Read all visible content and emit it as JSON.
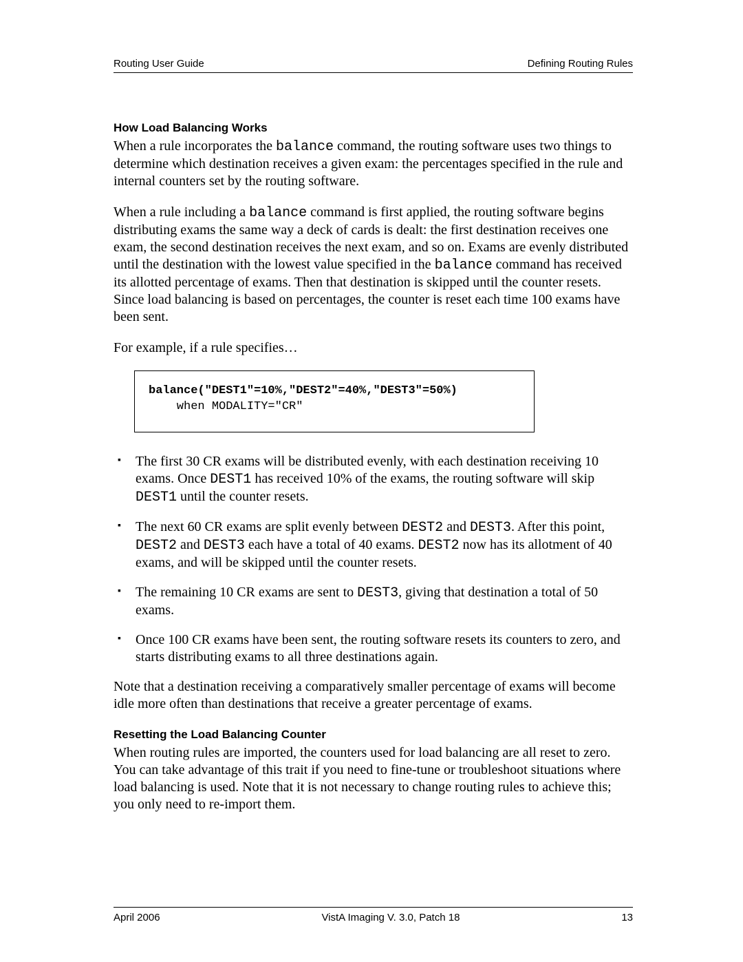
{
  "header": {
    "left": "Routing User Guide",
    "right": "Defining Routing Rules"
  },
  "section1": {
    "heading": "How Load Balancing Works",
    "p1_a": "When a rule incorporates the ",
    "p1_code": "balance",
    "p1_b": " command, the routing software uses two things to determine which destination receives a given exam: the percentages specified in the rule and internal counters set by the routing software.",
    "p2_a": "When a rule including a ",
    "p2_code1": "balance",
    "p2_b": " command is first applied, the routing software begins distributing exams the same way a deck of cards is dealt: the first destination receives one exam, the second destination receives the next exam, and so on. Exams are evenly distributed until the destination with the lowest value specified in the ",
    "p2_code2": "balance",
    "p2_c": " command has received its allotted percentage of exams. Then that destination is skipped until the counter resets. Since load balancing is based on percentages, the counter is reset each time 100 exams have been sent.",
    "p3": "For example, if a rule specifies…"
  },
  "codebox": {
    "line1": "balance(\"DEST1\"=10%,\"DEST2\"=40%,\"DEST3\"=50%)",
    "line2": "    when MODALITY=\"CR\""
  },
  "bullets": {
    "b1_a": "The first 30 CR exams will be distributed evenly, with each destination receiving 10 exams. Once ",
    "b1_code1": "DEST1",
    "b1_b": " has received 10% of the exams, the routing software will skip ",
    "b1_code2": "DEST1",
    "b1_c": " until the counter resets.",
    "b2_a": "The next 60 CR exams are split evenly between ",
    "b2_code1": "DEST2",
    "b2_b": " and ",
    "b2_code2": "DEST3",
    "b2_c": ". After this point, ",
    "b2_code3": "DEST2",
    "b2_d": " and ",
    "b2_code4": "DEST3",
    "b2_e": " each have a total of 40 exams. ",
    "b2_code5": "DEST2",
    "b2_f": " now has its allotment of 40 exams, and will be skipped until the counter resets.",
    "b3_a": "The remaining 10 CR exams are sent to ",
    "b3_code1": "DEST3",
    "b3_b": ", giving that destination a total of 50 exams.",
    "b4": "Once 100 CR exams have been sent, the routing software resets its counters to zero, and starts distributing exams to all three destinations again."
  },
  "note": "Note that a destination receiving a comparatively smaller percentage of exams will become idle more often than destinations that receive a greater percentage of exams.",
  "section2": {
    "heading": "Resetting the Load Balancing Counter",
    "p1": "When routing rules are imported, the counters used for load balancing are all reset to zero. You can take advantage of this trait if you need to fine-tune or troubleshoot situations where load balancing is used. Note that it is not necessary to change routing rules to achieve this; you only need to re-import them."
  },
  "footer": {
    "left": "April 2006",
    "center": "VistA Imaging V. 3.0, Patch 18",
    "right": "13"
  }
}
